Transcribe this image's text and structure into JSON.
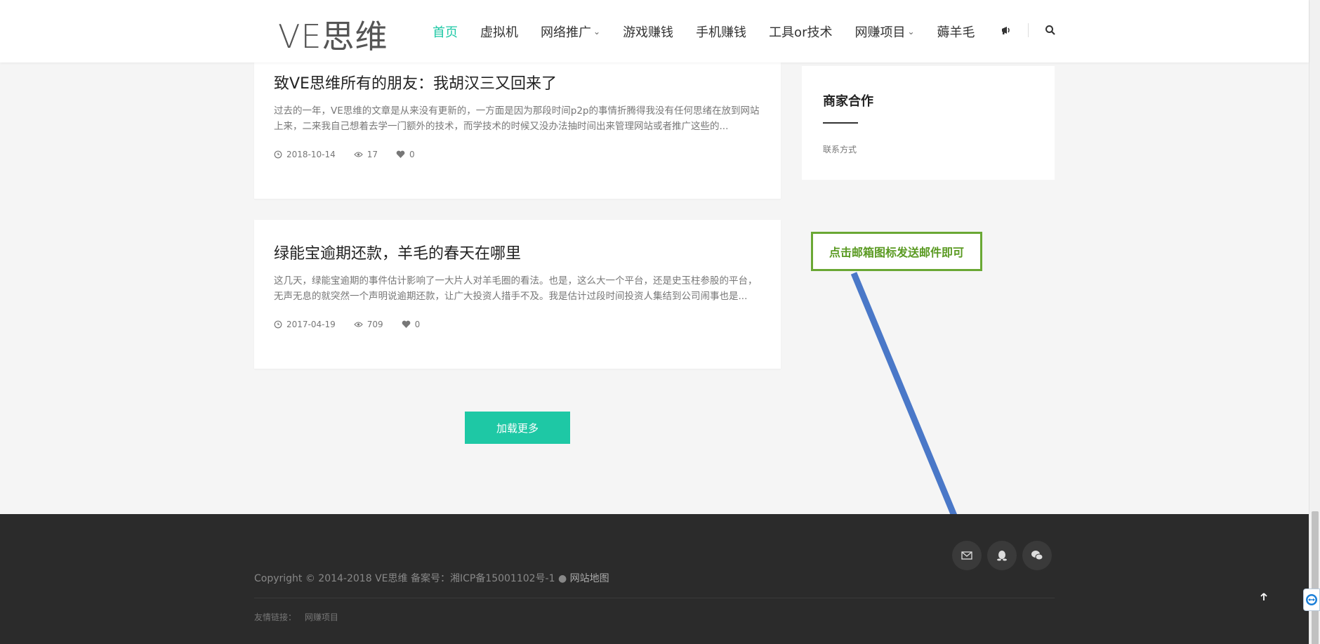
{
  "header": {
    "logo": "VE思维",
    "nav": [
      {
        "label": "首页",
        "active": true,
        "dropdown": false
      },
      {
        "label": "虚拟机",
        "active": false,
        "dropdown": false
      },
      {
        "label": "网络推广",
        "active": false,
        "dropdown": true
      },
      {
        "label": "游戏赚钱",
        "active": false,
        "dropdown": false
      },
      {
        "label": "手机赚钱",
        "active": false,
        "dropdown": false
      },
      {
        "label": "工具or技术",
        "active": false,
        "dropdown": false
      },
      {
        "label": "网赚项目",
        "active": false,
        "dropdown": true
      },
      {
        "label": "薅羊毛",
        "active": false,
        "dropdown": false
      }
    ],
    "icons": [
      "megaphone-icon",
      "search-icon"
    ]
  },
  "posts": [
    {
      "title": "致VE思维所有的朋友：我胡汉三又回来了",
      "excerpt": "过去的一年，VE思维的文章是从来没有更新的，一方面是因为那段时间p2p的事情折腾得我没有任何思绪在放到网站上来，二来我自己想着去学一门额外的技术，而学技术的时候又没办法抽时间出来管理网站或者推广这些的...",
      "date": "2018-10-14",
      "views": "17",
      "likes": "0"
    },
    {
      "title": "绿能宝逾期还款，羊毛的春天在哪里",
      "excerpt": "这几天，绿能宝逾期的事件估计影响了一大片人对羊毛圈的看法。也是，这么大一个平台，还是史玉柱参股的平台，无声无息的就突然一个声明说逾期还款，让广大投资人措手不及。我是估计过段时间投资人集结到公司闹事也是...",
      "date": "2017-04-19",
      "views": "709",
      "likes": "0"
    }
  ],
  "load_more": "加载更多",
  "sidebar": {
    "widget_title": "商家合作",
    "widget_link": "联系方式"
  },
  "annotation": {
    "text": "点击邮箱图标发送邮件即可"
  },
  "footer": {
    "copyright": "Copyright © 2014-2018 VE思维 备案号：湘ICP备15001102号-1 ● ",
    "sitemap": "网站地图",
    "friends_label": "友情链接：",
    "friends_link": "网赚项目",
    "social": [
      "mail-icon",
      "qq-icon",
      "wechat-icon"
    ]
  },
  "colors": {
    "accent": "#1ec8a5",
    "footer_bg": "#2b2b2b",
    "annotation_border": "#6aa834",
    "arrow": "#4a78c8"
  }
}
